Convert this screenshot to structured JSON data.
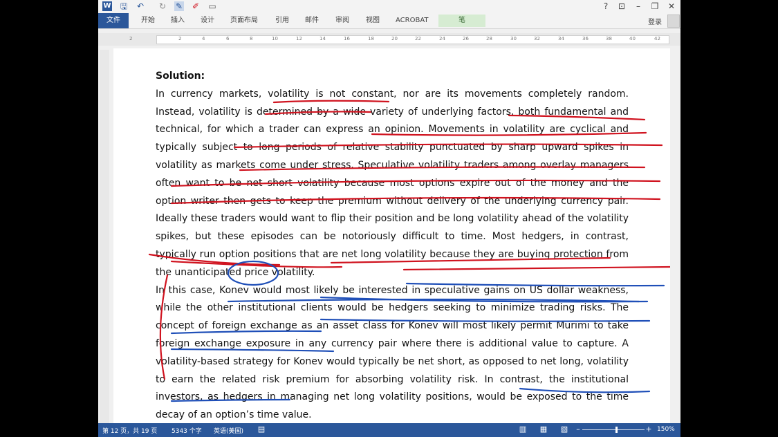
{
  "quick_access": {
    "word_icon": "W",
    "save_icon": "🖫",
    "undo_icon": "↶",
    "redo_icon": "↻",
    "pen_icon": "✎",
    "marker_icon": "✐",
    "layout_icon": "▭"
  },
  "window_controls": {
    "help": "?",
    "ribbon_display": "⊡",
    "minimize": "–",
    "restore": "❐",
    "close": "✕"
  },
  "ribbon": {
    "file_tab": "文件",
    "tabs": [
      "开始",
      "插入",
      "设计",
      "页面布局",
      "引用",
      "邮件",
      "审阅",
      "视图",
      "ACROBAT"
    ],
    "pen_tab": "笔",
    "login": "登录"
  },
  "ruler": {
    "ticks": [
      "2",
      "2",
      "4",
      "6",
      "8",
      "10",
      "12",
      "14",
      "16",
      "18",
      "20",
      "22",
      "24",
      "26",
      "28",
      "30",
      "32",
      "34",
      "36",
      "38",
      "40",
      "42"
    ]
  },
  "document": {
    "heading": "Solution:",
    "paragraph1": "In currency markets, volatility is not constant, nor are its movements completely random. Instead, volatility is determined by a wide variety of underlying factors, both fundamental and technical, for which a trader can express an opinion. Movements in volatility are cyclical and typically subject to long periods of relative stability punctuated by sharp upward spikes in volatility as markets come under stress. Speculative volatility traders among overlay managers often want to be net short volatility because most options expire out of the money and the option writer then gets to keep the premium without delivery of the underlying currency pair. Ideally these traders would want to flip their position and be long volatility ahead of the volatility spikes, but these episodes can be notoriously difficult to time. Most hedgers, in contrast, typically run option positions that are net long volatility because they are buying protection from the unanticipated price volatility.",
    "paragraph2": "In this case, Konev would most likely be interested in speculative gains on US dollar weakness, while the other institutional clients would be hedgers seeking to minimize trading risks. The concept of foreign exchange as an asset class for Konev will most likely permit Murimi to take foreign exchange exposure in any currency pair where there is additional value to capture. A volatility-based strategy for Konev would typically be net short, as opposed to net long, volatility to earn the related risk premium for absorbing volatility risk. In contrast, the institutional investors, as hedgers in managing net long volatility positions, would be exposed to the time decay of an option’s time value."
  },
  "colors": {
    "ribbon_blue": "#2b579a",
    "red_ink": "#d0131f",
    "blue_ink": "#1f4fb8"
  },
  "status_bar": {
    "page": "第 12 页，共 19 页",
    "words": "5343 个字",
    "language": "英语(美国)",
    "proofing_icon": "▤",
    "read_mode_icon": "▥",
    "print_layout_icon": "▦",
    "web_layout_icon": "▧",
    "zoom_out": "–",
    "zoom_in": "+",
    "zoom": "150%"
  }
}
